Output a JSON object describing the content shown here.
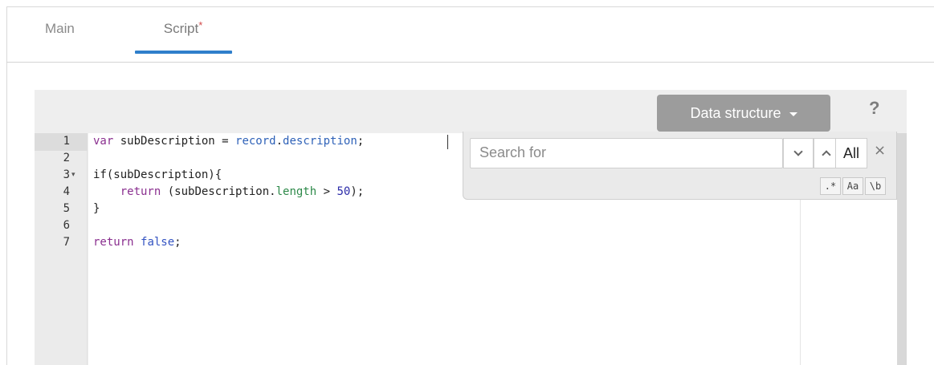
{
  "tabs": {
    "main_label": "Main",
    "script_label": "Script",
    "script_required_mark": "*"
  },
  "toolbar": {
    "data_structure_label": "Data structure",
    "help_label": "?"
  },
  "editor": {
    "line_numbers": [
      "1",
      "2",
      "3",
      "4",
      "5",
      "6",
      "7"
    ],
    "fold_marker": "▾",
    "lines": {
      "l1": {
        "kw": "var",
        "a": " subDescription = ",
        "b": "record",
        "c": ".",
        "d": "description",
        "e": ";"
      },
      "l3": {
        "a": "if(subDescription){"
      },
      "l4": {
        "indent": "    ",
        "kw": "return",
        "a": " (subDescription.",
        "b": "length",
        "c": " > ",
        "d": "50",
        "e": ");"
      },
      "l5": {
        "a": "}"
      },
      "l7": {
        "kw": "return",
        "a": " ",
        "b": "false",
        "c": ";"
      }
    }
  },
  "search": {
    "placeholder": "Search for",
    "all_label": "All",
    "close_label": "×",
    "regex_label": ".*",
    "case_label": "Aa",
    "word_label": "\\b"
  },
  "colors": {
    "tab_underline": "#2f7fcb",
    "button_bg": "#9c9c9c",
    "keyword": "#8a2f8f",
    "property": "#2f62b8"
  }
}
